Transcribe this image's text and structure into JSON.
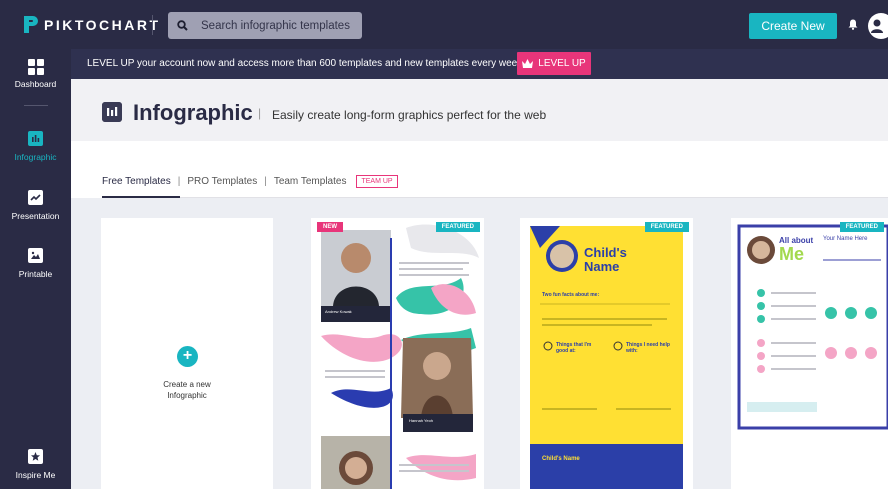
{
  "app": {
    "logo_text": "PIKTOCHART",
    "colors": {
      "navy": "#2a2b45",
      "teal": "#19b5c1",
      "pink": "#e8357a",
      "yellow": "#ffe033",
      "blue": "#2b3fa8"
    }
  },
  "topbar": {
    "search_placeholder": "Search infographic templates",
    "create_label": "Create New",
    "bell_icon": "bell-icon",
    "user_icon": "user-icon"
  },
  "sidebar": {
    "items": [
      {
        "label": "Dashboard",
        "icon": "grid-icon"
      },
      {
        "label": "Infographic",
        "icon": "bar-chart-icon",
        "active": true
      },
      {
        "label": "Presentation",
        "icon": "presentation-icon"
      },
      {
        "label": "Printable",
        "icon": "image-icon"
      },
      {
        "label": "Inspire Me",
        "icon": "star-icon"
      }
    ]
  },
  "banner": {
    "text": "LEVEL UP your account now and access more than 600 templates and new templates every week.",
    "button_label": "LEVEL UP",
    "button_icon": "crown-icon"
  },
  "header": {
    "title": "Infographic",
    "separator": "|",
    "subtitle": "Easily create long-form graphics perfect for the web"
  },
  "tabs": {
    "items": [
      "Free Templates",
      "PRO Templates",
      "Team Templates"
    ],
    "active": "Free Templates",
    "separator": "|",
    "badge": "TEAM UP"
  },
  "create_card": {
    "label_line1": "Create a new",
    "label_line2": "Infographic"
  },
  "templates": [
    {
      "badges": [
        "NEW",
        "FEATURED"
      ],
      "captions": [
        "Andrew Kowak",
        "Hannah Yeoh"
      ]
    },
    {
      "badges": [
        "FEATURED"
      ],
      "title_line1": "Child's",
      "title_line2": "Name",
      "subheading": "Two fun facts about me:",
      "fact1": "Things that I'm good at:",
      "fact2": "Things I need help with:",
      "footer_title": "Child's Name"
    },
    {
      "badges": [
        "FEATURED"
      ],
      "title_line1": "All about",
      "title_line2": "Me",
      "name_placeholder": "Your Name Here"
    }
  ]
}
